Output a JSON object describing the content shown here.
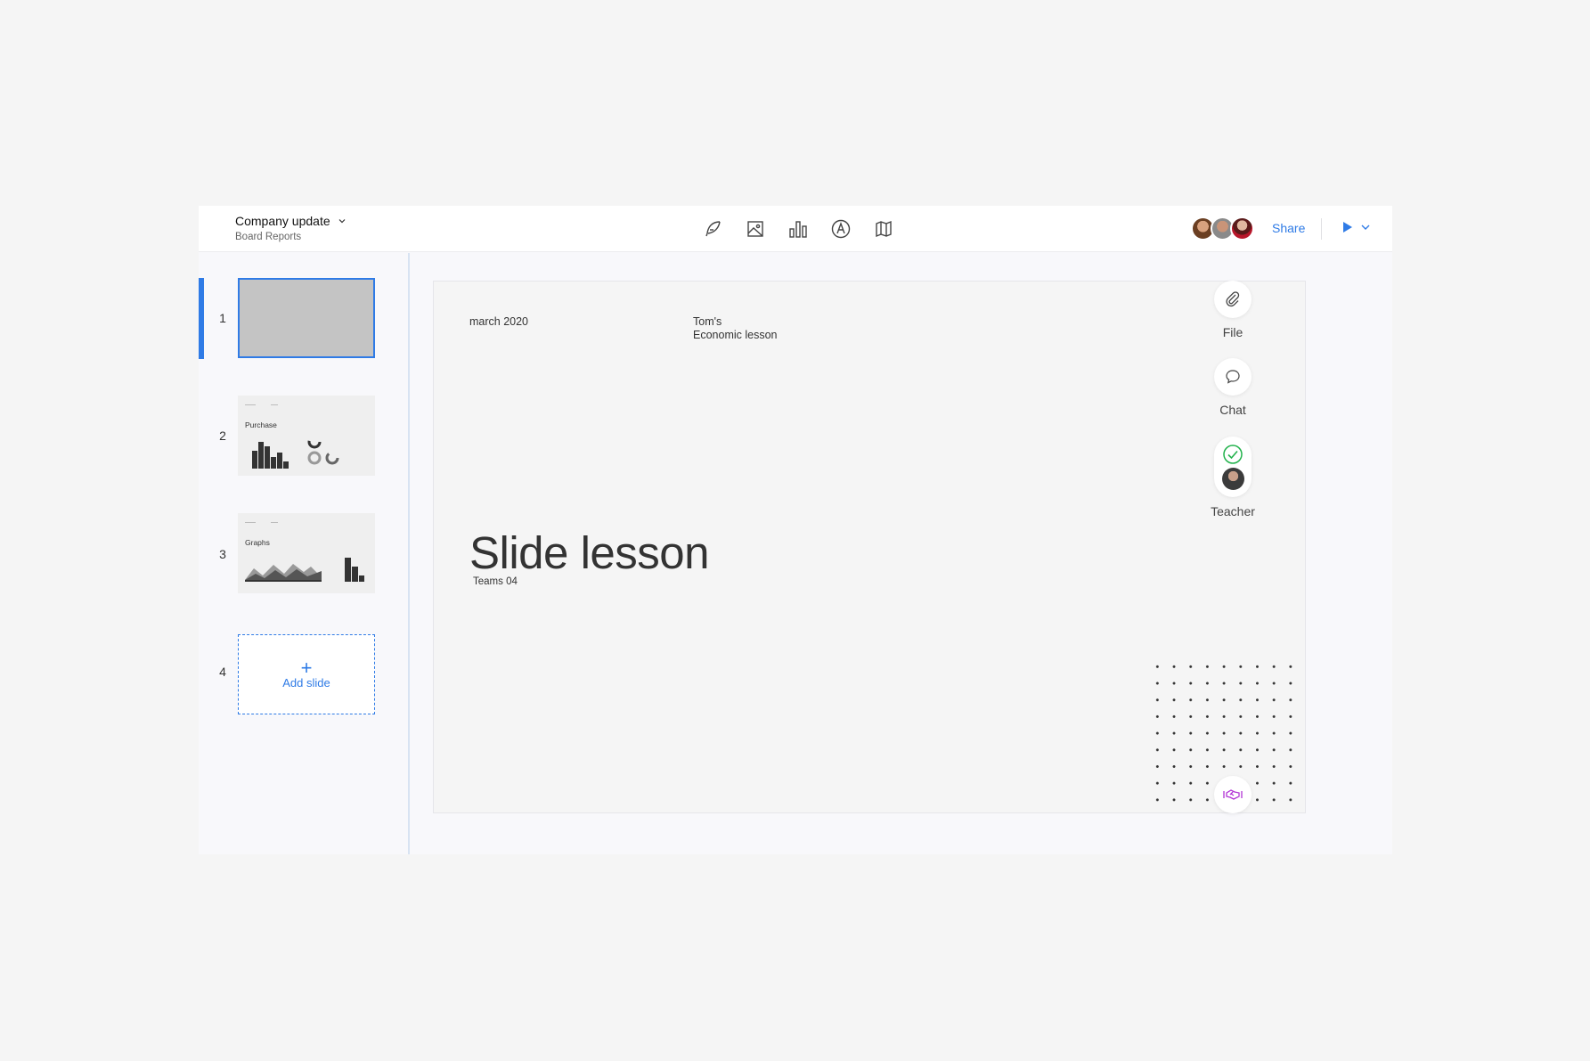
{
  "header": {
    "title": "Company update",
    "subtitle": "Board Reports",
    "share_label": "Share",
    "tools": [
      "feather-icon",
      "image-icon",
      "bar-chart-icon",
      "typography-icon",
      "map-icon"
    ]
  },
  "sidebar": {
    "slides": [
      {
        "number": "1",
        "label": ""
      },
      {
        "number": "2",
        "label": "Purchase"
      },
      {
        "number": "3",
        "label": "Graphs"
      },
      {
        "number": "4",
        "label": ""
      }
    ],
    "add_slide_label": "Add slide"
  },
  "slide": {
    "date": "march 2020",
    "author_line1": "Tom's",
    "author_line2": "Economic lesson",
    "title": "Slide lesson",
    "subtitle": "Teams 04"
  },
  "rail": {
    "file_label": "File",
    "chat_label": "Chat",
    "teacher_label": "Teacher"
  },
  "colors": {
    "accent": "#2f7be6",
    "check": "#22b24c",
    "brand_icon": "#b235d6"
  }
}
